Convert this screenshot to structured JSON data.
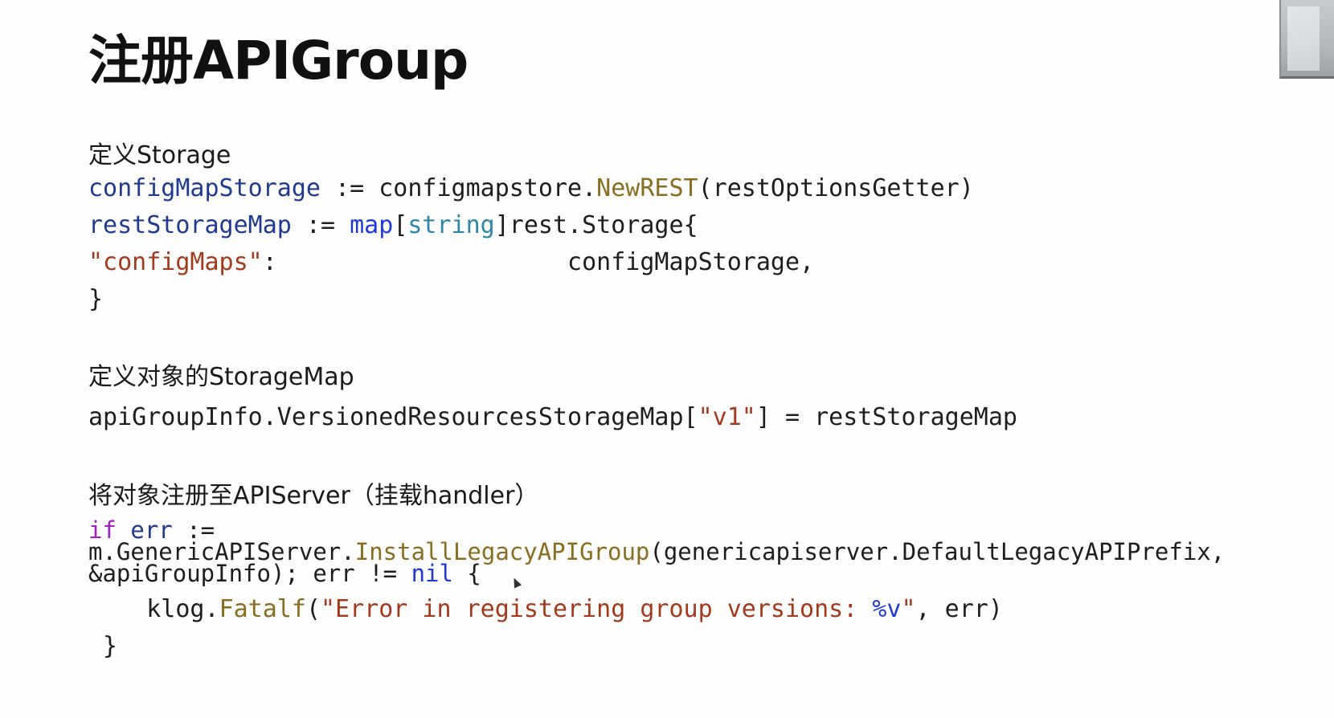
{
  "slide": {
    "title": "注册APIGroup",
    "sections": [
      {
        "heading": "定义Storage",
        "lines": [
          [
            "configMapStorage",
            " := configmapstore.",
            "NewREST",
            "(restOptionsGetter)"
          ],
          [
            "restStorageMap",
            " := ",
            "map",
            "[",
            "string",
            "]rest.Storage{"
          ],
          [
            "\"configMaps\"",
            ":                    configMapStorage,"
          ],
          [
            "}"
          ]
        ]
      },
      {
        "heading": "定义对象的StorageMap",
        "lines": [
          [
            "apiGroupInfo.VersionedResourcesStorageMap[",
            "\"v1\"",
            "] = restStorageMap"
          ]
        ]
      },
      {
        "heading": "将对象注册至APIServer（挂载handler）",
        "lines": [
          [
            "if",
            " err",
            " :="
          ],
          [
            "m.GenericAPIServer.",
            "InstallLegacyAPIGroup",
            "(genericapiserver.DefaultLegacyAPIPrefix,"
          ],
          [
            "&apiGroupInfo); err != ",
            "nil",
            " {"
          ],
          [
            "    klog.",
            "Fatalf",
            "(",
            "\"Error in registering group versions: ",
            "%v",
            "\"",
            ", err)"
          ],
          [
            " }"
          ]
        ]
      }
    ]
  }
}
